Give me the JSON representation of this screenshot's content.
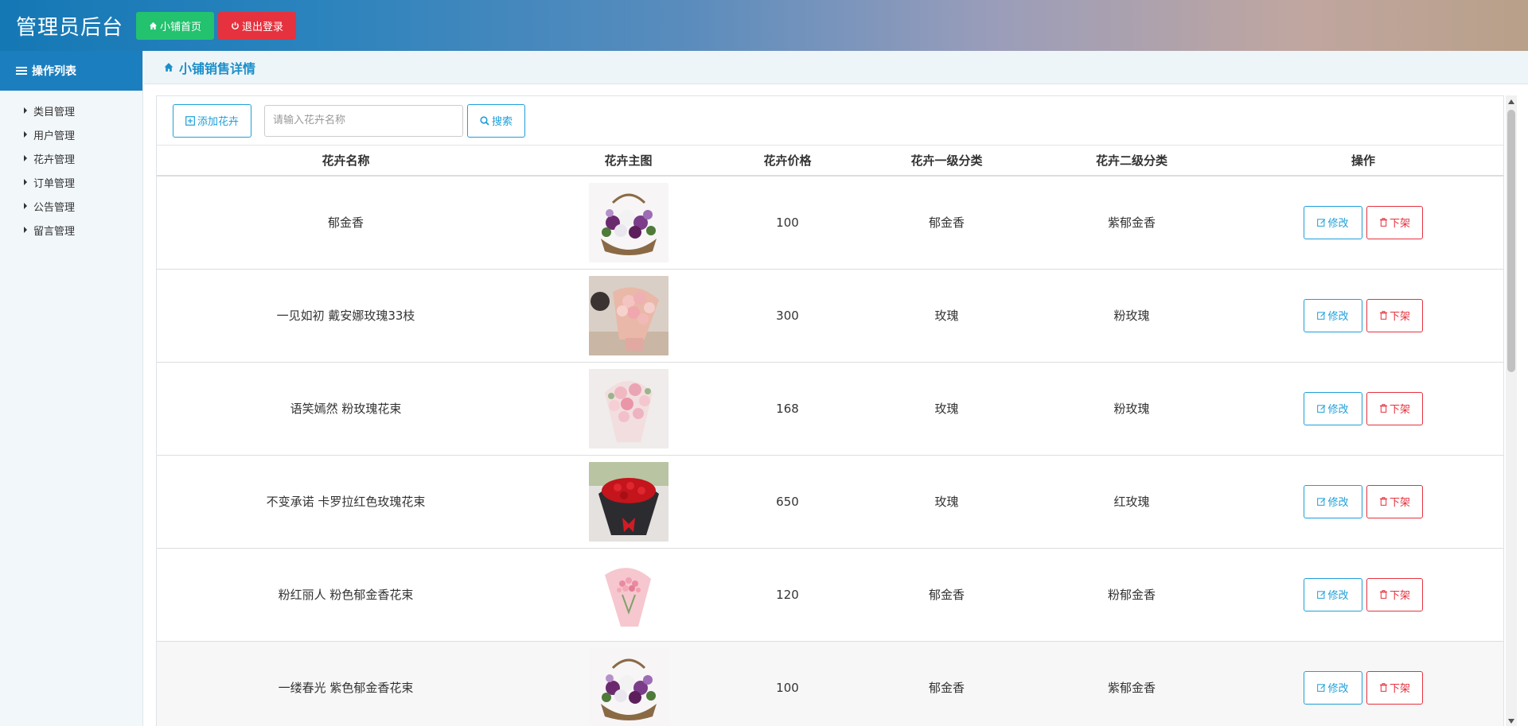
{
  "header": {
    "title": "管理员后台",
    "home_label": "小铺首页",
    "logout_label": "退出登录"
  },
  "sidebar": {
    "title": "操作列表",
    "items": [
      {
        "label": "类目管理"
      },
      {
        "label": "用户管理"
      },
      {
        "label": "花卉管理"
      },
      {
        "label": "订单管理"
      },
      {
        "label": "公告管理"
      },
      {
        "label": "留言管理"
      }
    ]
  },
  "breadcrumb": {
    "title": "小铺销售详情"
  },
  "toolbar": {
    "add_label": "添加花卉",
    "search_placeholder": "请输入花卉名称",
    "search_value": "",
    "search_label": "搜索"
  },
  "table": {
    "headers": [
      "花卉名称",
      "花卉主图",
      "花卉价格",
      "花卉一级分类",
      "花卉二级分类",
      "操作"
    ],
    "edit_label": "修改",
    "off_label": "下架",
    "rows": [
      {
        "name": "郁金香",
        "price": "100",
        "cat1": "郁金香",
        "cat2": "紫郁金香",
        "image": "purple-flower-basket"
      },
      {
        "name": "一见如初 戴安娜玫瑰33枝",
        "price": "300",
        "cat1": "玫瑰",
        "cat2": "粉玫瑰",
        "image": "pink-rose-bouquet-held"
      },
      {
        "name": "语笑嫣然 粉玫瑰花束",
        "price": "168",
        "cat1": "玫瑰",
        "cat2": "粉玫瑰",
        "image": "pink-rose-bouquet"
      },
      {
        "name": "不变承诺 卡罗拉红色玫瑰花束",
        "price": "650",
        "cat1": "玫瑰",
        "cat2": "红玫瑰",
        "image": "red-rose-bouquet"
      },
      {
        "name": "粉红丽人 粉色郁金香花束",
        "price": "120",
        "cat1": "郁金香",
        "cat2": "粉郁金香",
        "image": "pink-tulip-bouquet"
      },
      {
        "name": "一缕春光 紫色郁金香花束",
        "price": "100",
        "cat1": "郁金香",
        "cat2": "紫郁金香",
        "image": "purple-flower-basket"
      }
    ]
  },
  "colors": {
    "brand_blue": "#1b7fbf",
    "accent_blue": "#1e9fd9",
    "danger_red": "#e5323e",
    "success_green": "#23c26e"
  }
}
